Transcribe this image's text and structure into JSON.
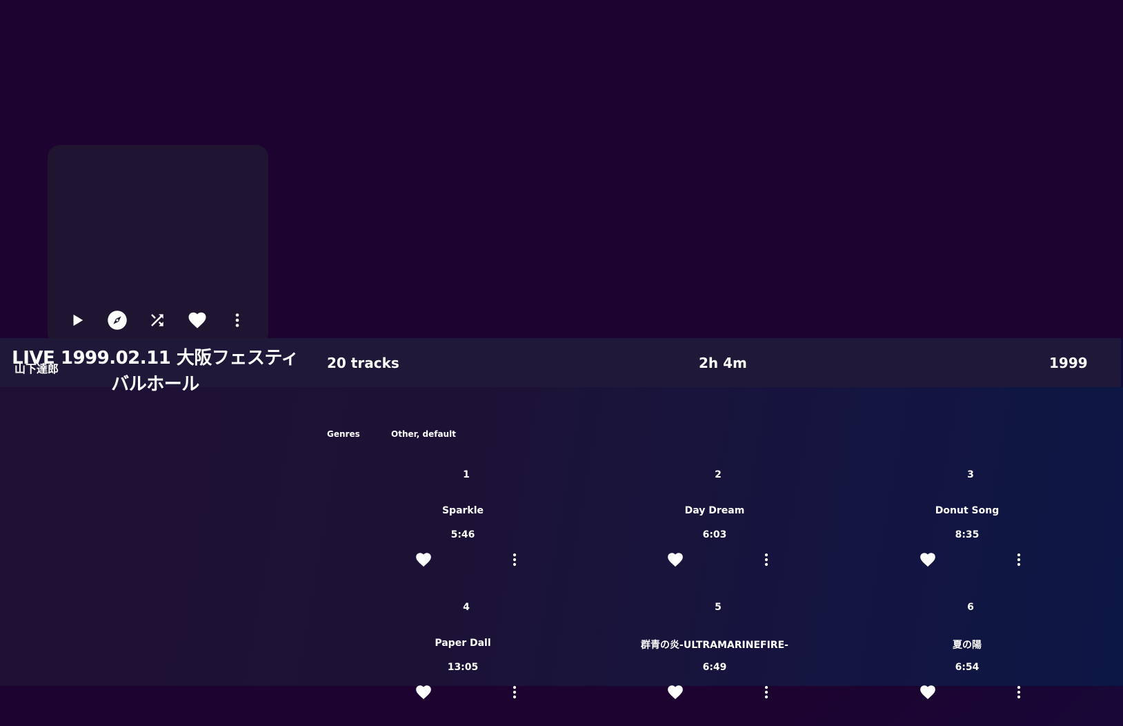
{
  "album": {
    "title": "LIVE 1999.02.11 大阪フェスティバルホール",
    "artist": "山下達郎"
  },
  "actions": {
    "play": "play-icon",
    "explore": "compass-icon",
    "shuffle": "shuffle-icon",
    "favorite": "heart-icon",
    "more": "more-vertical-icon"
  },
  "stats": {
    "tracks": "20 tracks",
    "duration": "2h 4m",
    "year": "1999"
  },
  "genres": {
    "label": "Genres",
    "value": "Other, default"
  },
  "tracks": [
    {
      "number": "1",
      "title": "Sparkle",
      "duration": "5:46"
    },
    {
      "number": "2",
      "title": "Day Dream",
      "duration": "6:03"
    },
    {
      "number": "3",
      "title": "Donut Song",
      "duration": "8:35"
    },
    {
      "number": "4",
      "title": "Paper Dall",
      "duration": "13:05"
    },
    {
      "number": "5",
      "title": "群青の炎-ULTRAMARINEFIRE-",
      "duration": "6:49"
    },
    {
      "number": "6",
      "title": "夏の陽",
      "duration": "6:54"
    }
  ],
  "colors": {
    "background": "#1c0330",
    "info_bar": "#1f1838",
    "card": "#1f1530",
    "text": "#ffffff"
  }
}
